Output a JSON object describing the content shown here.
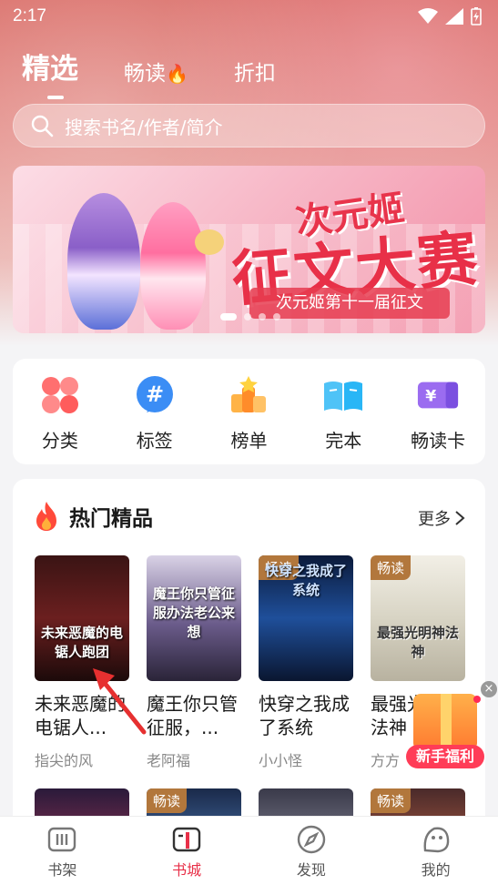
{
  "status_bar": {
    "time": "2:17"
  },
  "tabs": [
    {
      "label": "精选",
      "active": true
    },
    {
      "label": "畅读",
      "icon": "flame-icon"
    },
    {
      "label": "折扣"
    }
  ],
  "search": {
    "placeholder": "搜索书名/作者/简介"
  },
  "banner": {
    "title_small": "次元姬",
    "title_big": "征文大赛",
    "subtitle": "次元姬第十一届征文",
    "page_count": 4,
    "current_page": 1
  },
  "categories": [
    {
      "label": "分类",
      "icon": "category-icon"
    },
    {
      "label": "标签",
      "icon": "hashtag-icon"
    },
    {
      "label": "榜单",
      "icon": "ranking-icon"
    },
    {
      "label": "完本",
      "icon": "book-open-icon"
    },
    {
      "label": "畅读卡",
      "icon": "ticket-icon"
    }
  ],
  "hot": {
    "title": "热门精品",
    "more_label": "更多",
    "books": [
      {
        "title": "未来恶魔的电锯人...",
        "author": "指尖的风",
        "cover_text": "未来恶魔的电锯人跑团",
        "tag": ""
      },
      {
        "title": "魔王你只管征服，...",
        "author": "老阿福",
        "cover_text": "魔王你只管征服办法老公来想",
        "tag": ""
      },
      {
        "title": "快穿之我成了系统",
        "author": "小小怪",
        "cover_text": "快穿之我成了系统",
        "tag": "畅读"
      },
      {
        "title": "最强光明神法神",
        "author": "方方",
        "cover_text": "最强光明神法神",
        "tag": "畅读"
      }
    ],
    "row2_tags": [
      "",
      "畅读",
      "",
      "畅读"
    ]
  },
  "gift": {
    "label": "新手福利"
  },
  "bottom_nav": [
    {
      "label": "书架",
      "icon": "bookshelf-icon"
    },
    {
      "label": "书城",
      "icon": "bookstore-icon",
      "active": true
    },
    {
      "label": "发现",
      "icon": "compass-icon"
    },
    {
      "label": "我的",
      "icon": "profile-icon"
    }
  ],
  "colors": {
    "accent": "#e83048",
    "tag": "#b2773c"
  }
}
